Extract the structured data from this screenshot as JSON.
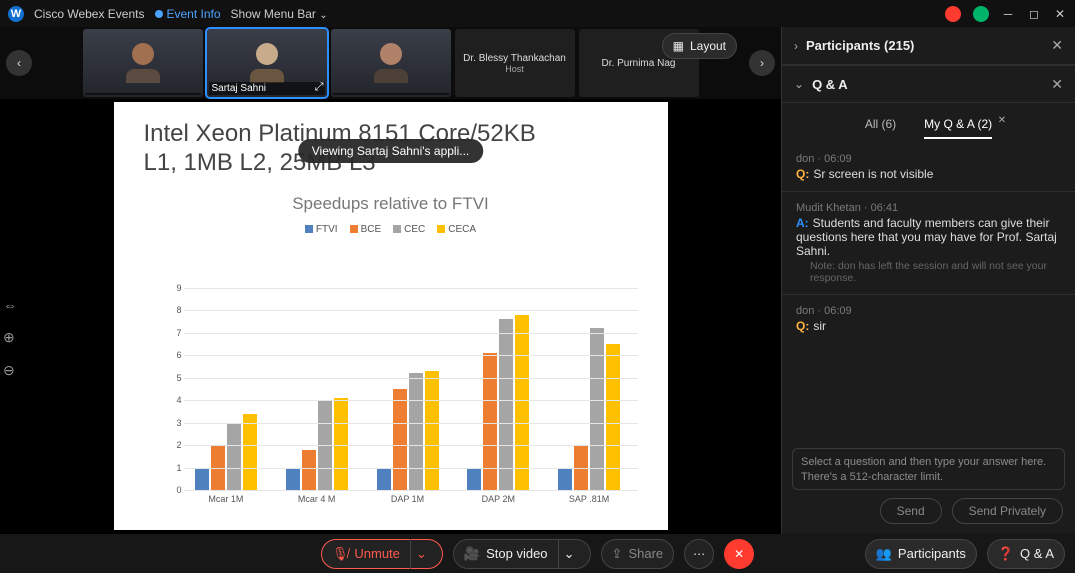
{
  "titlebar": {
    "app_name": "Cisco Webex Events",
    "event_info": "Event Info",
    "show_menu": "Show Menu Bar"
  },
  "layout_label": "Layout",
  "sharing_pill": "Viewing Sartaj Sahni's appli...",
  "participants_row": {
    "p1_name": "",
    "p2_name": "Sartaj Sahni",
    "p3_name": "",
    "p4_name": "Dr. Blessy Thankachan",
    "p4_role": "Host",
    "p5_name": "Dr. Purnima Nag"
  },
  "slide": {
    "title_l1": "Intel Xeon Platinum 8151 Core/52KB",
    "title_l2": "L1, 1MB L2, 25MB L3"
  },
  "chart_data": {
    "type": "bar",
    "title": "Speedups relative to FTVI",
    "legend": [
      "FTVI",
      "BCE",
      "CEC",
      "CECA"
    ],
    "colors": {
      "FTVI": "#4e81bd",
      "BCE": "#ed7d31",
      "CEC": "#a5a5a5",
      "CECA": "#ffc000"
    },
    "categories": [
      "Mcar 1M",
      "Mcar 4 M",
      "DAP 1M",
      "DAP 2M",
      "SAP .81M"
    ],
    "series": [
      {
        "name": "FTVI",
        "values": [
          1,
          1,
          1,
          1,
          1
        ]
      },
      {
        "name": "BCE",
        "values": [
          2.0,
          1.8,
          4.5,
          6.1,
          2.0
        ]
      },
      {
        "name": "CEC",
        "values": [
          3.0,
          4.0,
          5.2,
          7.6,
          7.2
        ]
      },
      {
        "name": "CECA",
        "values": [
          3.4,
          4.1,
          5.3,
          7.8,
          6.5
        ]
      }
    ],
    "ylim": [
      0,
      9
    ],
    "yticks": [
      0,
      1,
      2,
      3,
      4,
      5,
      6,
      7,
      8,
      9
    ]
  },
  "side": {
    "participants_title": "Participants (215)",
    "qa_title": "Q & A",
    "tabs": {
      "all": "All (6)",
      "mine": "My Q & A (2)"
    },
    "items": [
      {
        "meta": "don · 06:09",
        "type": "q",
        "text": "Sr screen is not visible"
      },
      {
        "meta": "Mudit Khetan · 06:41",
        "type": "a",
        "text": "Students and faculty members can give their questions here that you may have for Prof. Sartaj Sahni.",
        "note": "Note: don has left the session and will not see your response."
      },
      {
        "meta": "don · 06:09",
        "type": "q",
        "text": "sir"
      }
    ],
    "placeholder": "Select a question and then type your answer here. There's a 512-character limit.",
    "send": "Send",
    "send_private": "Send Privately"
  },
  "bottom": {
    "unmute": "Unmute",
    "stop_video": "Stop video",
    "share": "Share",
    "participants": "Participants",
    "qa": "Q & A"
  }
}
